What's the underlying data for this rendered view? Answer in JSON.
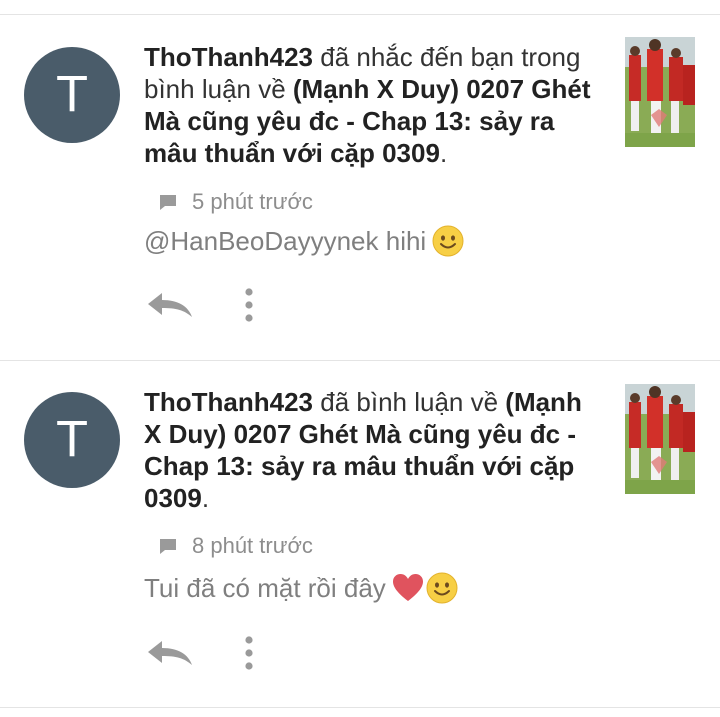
{
  "notifications": [
    {
      "avatar_letter": "T",
      "user": "ThoThanh423",
      "action": " đã nhắc đến bạn trong bình luận về ",
      "story": "(Mạnh X Duy) 0207 Ghét Mà cũng yêu đc - Chap 13: sảy ra mâu thuẩn với cặp 0309",
      "end": ".",
      "time": "5 phút trước",
      "comment": "@HanBeoDayyynek hihi",
      "emojis": [
        "smile-emoji"
      ]
    },
    {
      "avatar_letter": "T",
      "user": "ThoThanh423",
      "action": " đã bình luận về ",
      "story": "(Mạnh X Duy) 0207 Ghét Mà cũng yêu đc - Chap 13: sảy ra mâu thuẩn với cặp 0309",
      "end": ".",
      "time": "8 phút trước",
      "comment": "Tui đã có mặt rồi đây",
      "emojis": [
        "heart-emoji",
        "smile-emoji"
      ]
    }
  ],
  "colors": {
    "avatar_bg": "#4a5c6a",
    "text_primary": "#222222",
    "text_muted": "#8d8d8d",
    "divider": "#e4e4e4",
    "heart": "#e0535e",
    "emoji_face": "#f7cf45"
  }
}
